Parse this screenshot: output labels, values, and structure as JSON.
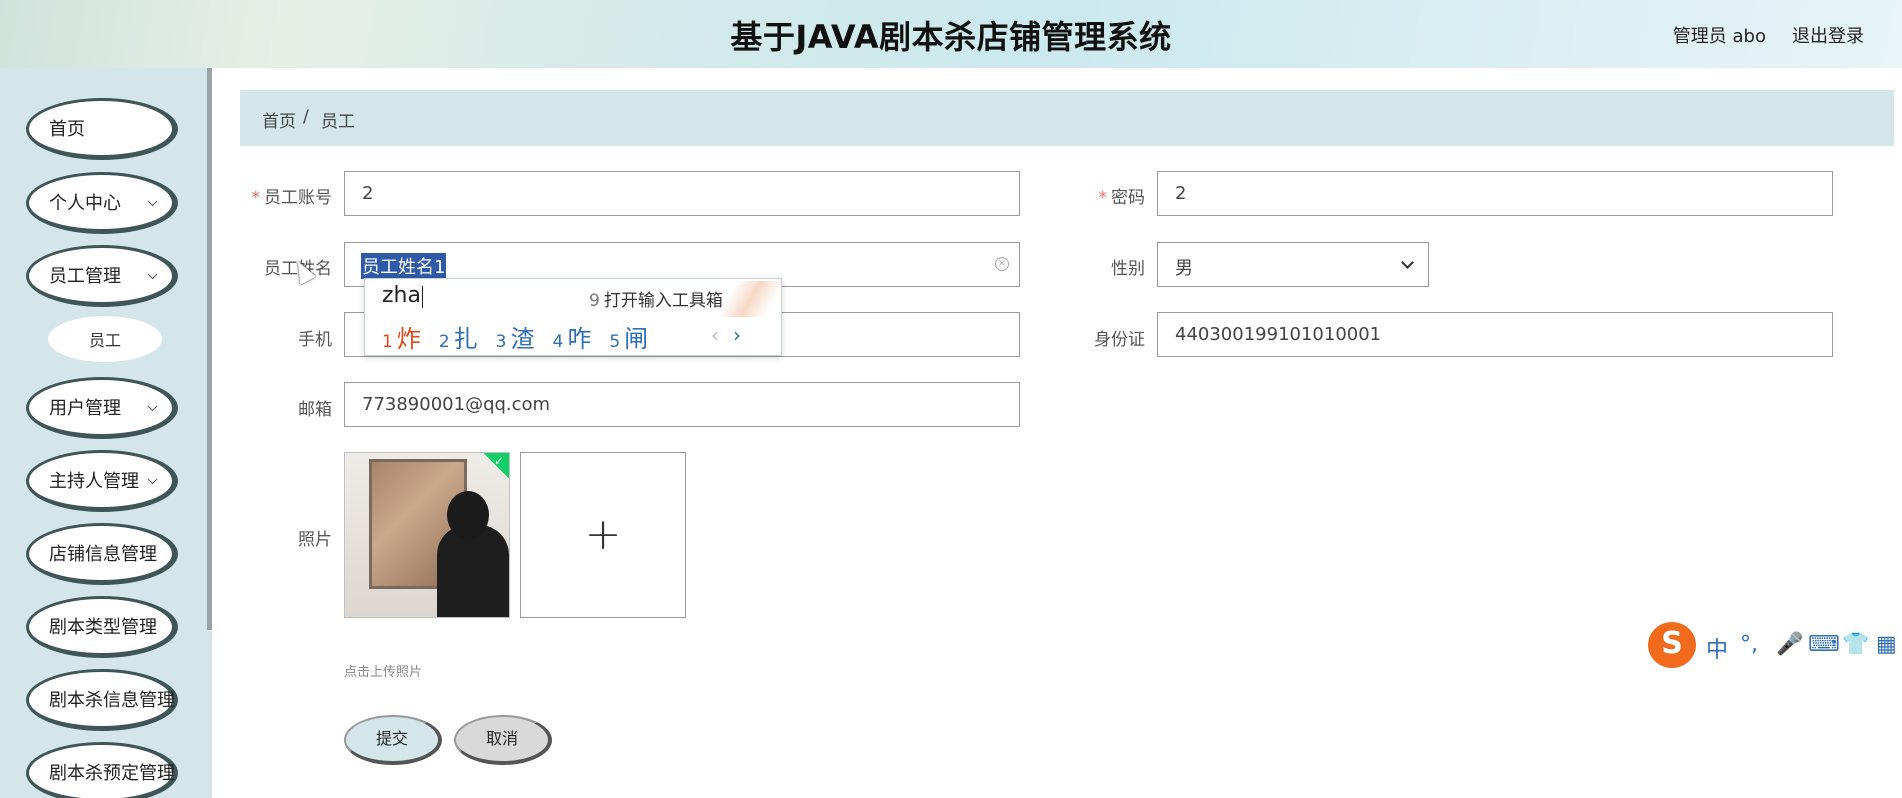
{
  "header": {
    "title": "基于JAVA剧本杀店铺管理系统",
    "user": "管理员 abo",
    "logout": "退出登录"
  },
  "sidebar": {
    "items": [
      {
        "label": "首页"
      },
      {
        "label": "个人中心"
      },
      {
        "label": "员工管理"
      },
      {
        "label": "员工"
      },
      {
        "label": "用户管理"
      },
      {
        "label": "主持人管理"
      },
      {
        "label": "店铺信息管理"
      },
      {
        "label": "剧本类型管理"
      },
      {
        "label": "剧本杀信息管理"
      },
      {
        "label": "剧本杀预定管理"
      }
    ]
  },
  "breadcrumb": {
    "home": "首页",
    "sep": "/",
    "current": "员工"
  },
  "form": {
    "account_label": "员工账号",
    "account_value": "2",
    "password_label": "密码",
    "password_value": "2",
    "name_label": "员工姓名",
    "name_value": "员工姓名1",
    "gender_label": "性别",
    "gender_value": "男",
    "phone_label": "手机",
    "id_label": "身份证",
    "id_value": "440300199101010001",
    "email_label": "邮箱",
    "email_value": "773890001@qq.com",
    "photo_label": "照片",
    "upload_tip": "点击上传照片",
    "submit": "提交",
    "cancel": "取消"
  },
  "ime": {
    "pinyin": "zha",
    "toolbox_num": "9",
    "toolbox": "打开输入工具箱",
    "candidates": [
      {
        "n": "1",
        "c": "炸"
      },
      {
        "n": "2",
        "c": "扎"
      },
      {
        "n": "3",
        "c": "渣"
      },
      {
        "n": "4",
        "c": "咋"
      },
      {
        "n": "5",
        "c": "闸"
      }
    ]
  },
  "ime_bar": {
    "logo": "S",
    "mode": "中",
    "punct": "°,"
  }
}
